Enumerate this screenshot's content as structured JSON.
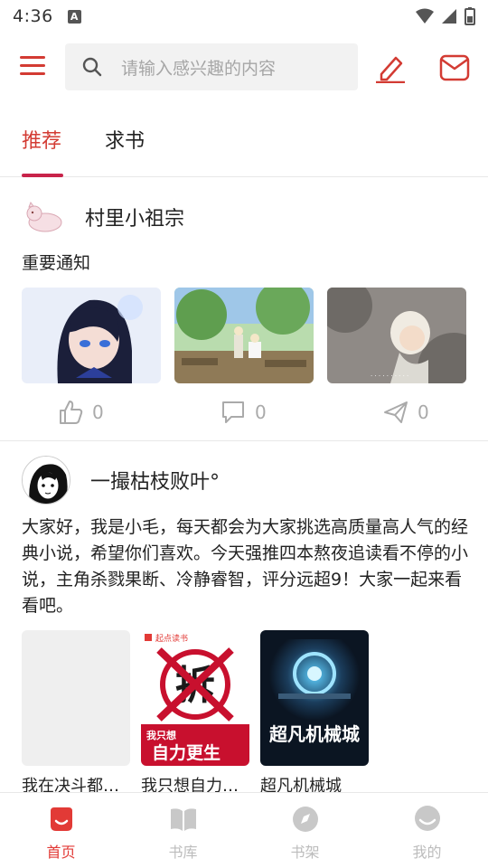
{
  "status": {
    "time": "4:36",
    "notif_glyph": "A"
  },
  "topbar": {
    "search_placeholder": "请输入感兴趣的内容"
  },
  "tabs": [
    {
      "label": "推荐",
      "active": true
    },
    {
      "label": "求书",
      "active": false
    }
  ],
  "posts": [
    {
      "author": "村里小祖宗",
      "text": "重要通知",
      "likes": "0",
      "comments": "0",
      "shares": "0"
    },
    {
      "author": "一撮枯枝败叶°",
      "text": "大家好，我是小毛，每天都会为大家挑选高质量高人气的经典小说，希望你们喜欢。今天强推四本熬夜追读看不停的小说，主角杀戮果断、冷静睿智，评分远超9！大家一起来看看吧。",
      "books": [
        {
          "title": "我在决斗都市..."
        },
        {
          "title": "我只想自力更生",
          "cover_top": "起点读书",
          "cover_main": "拆",
          "cover_sub": "我只想",
          "cover_big": "自力更生"
        },
        {
          "title": "超凡机械城",
          "cover_main": "超凡机械城"
        }
      ]
    }
  ],
  "bottom_nav": [
    {
      "label": "首页",
      "active": true
    },
    {
      "label": "书库",
      "active": false
    },
    {
      "label": "书架",
      "active": false
    },
    {
      "label": "我的",
      "active": false
    }
  ],
  "colors": {
    "accent": "#d33b33",
    "tab_underline": "#c8234a",
    "nav_active": "#e23a36",
    "muted": "#aaaaaa"
  }
}
